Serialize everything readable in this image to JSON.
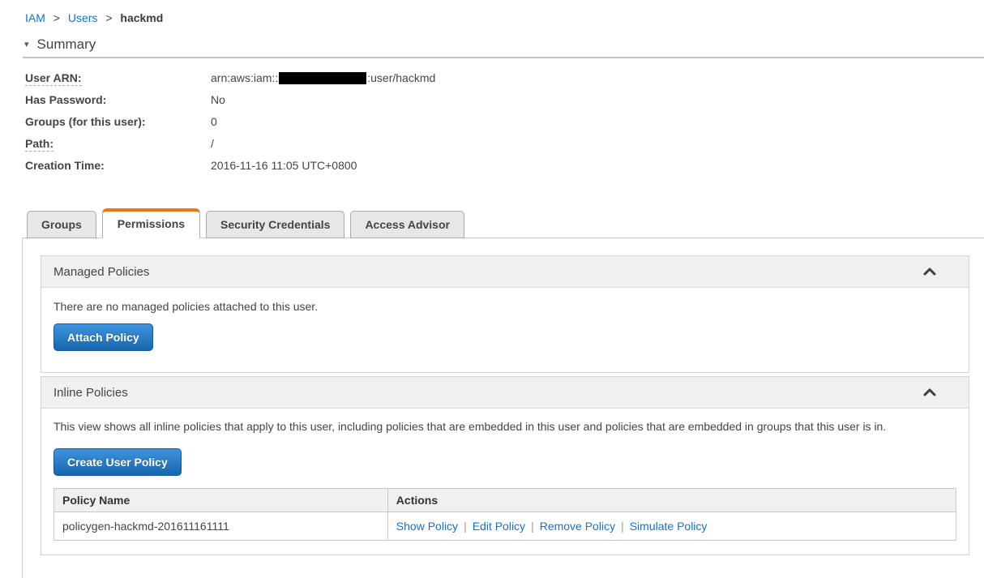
{
  "colors": {
    "link_blue": "#1170d8",
    "tab_active_accent_orange": "#e8790d",
    "button_gradient_top": "#3f93de",
    "button_gradient_bottom": "#1766ae",
    "section_header_bg": "#f0f0f0"
  },
  "icons": {
    "summary_collapse_triangle": "▾",
    "section_collapse_chevron": "chevron-up"
  },
  "breadcrumb": {
    "separator": ">",
    "items": [
      "IAM",
      "Users",
      "hackmd"
    ]
  },
  "summary": {
    "title": "Summary",
    "fields": [
      {
        "label": "User ARN:",
        "value_prefix": "arn:aws:iam::",
        "redacted": true,
        "value_suffix": ":user/hackmd"
      },
      {
        "label": "Has Password:",
        "value": "No"
      },
      {
        "label": "Groups (for this user):",
        "value": "0"
      },
      {
        "label": "Path:",
        "value": "/"
      },
      {
        "label": "Creation Time:",
        "value": "2016-11-16 11:05 UTC+0800"
      }
    ]
  },
  "tabs": [
    {
      "label": "Groups",
      "active": false
    },
    {
      "label": "Permissions",
      "active": true
    },
    {
      "label": "Security Credentials",
      "active": false
    },
    {
      "label": "Access Advisor",
      "active": false
    }
  ],
  "managed_policies": {
    "title": "Managed Policies",
    "empty_text": "There are no managed policies attached to this user.",
    "attach_button_label": "Attach Policy"
  },
  "inline_policies": {
    "title": "Inline Policies",
    "description": "This view shows all inline policies that apply to this user, including policies that are embedded in this user and policies that are embedded in groups that this user is in.",
    "create_button_label": "Create User Policy",
    "actions_separator": "|",
    "table": {
      "headers": [
        "Policy Name",
        "Actions"
      ],
      "rows": [
        {
          "policy_name": "policygen-hackmd-201611161111",
          "actions": [
            "Show Policy",
            "Edit Policy",
            "Remove Policy",
            "Simulate Policy"
          ]
        }
      ]
    }
  }
}
